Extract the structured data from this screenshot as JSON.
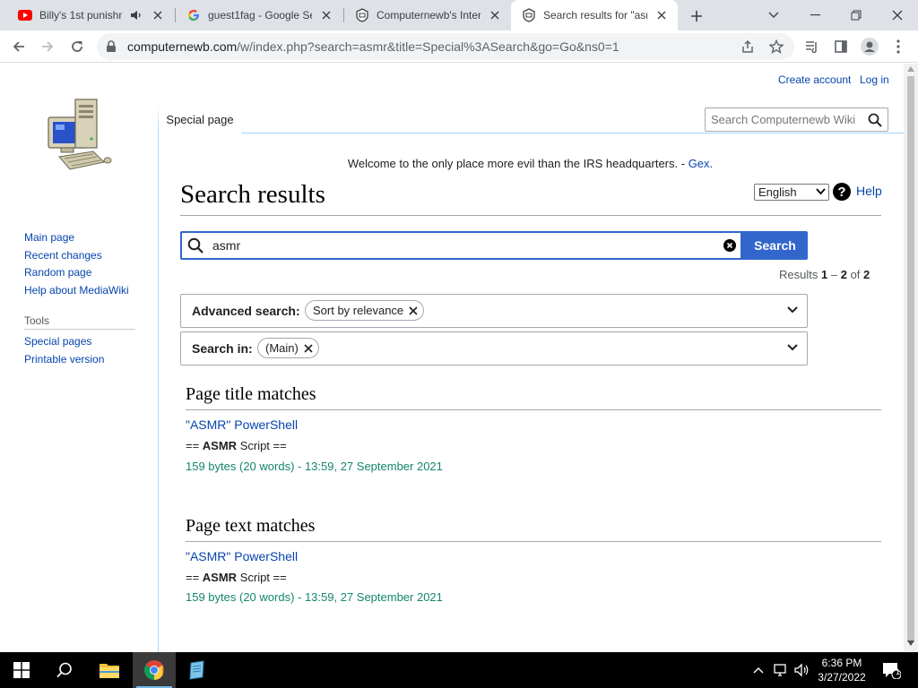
{
  "browser": {
    "tabs": [
      {
        "title": "Billy's 1st punishme",
        "icon": "youtube-icon",
        "audio": true
      },
      {
        "title": "guest1fag - Google Se",
        "icon": "google-icon"
      },
      {
        "title": "Computernewb's Intern",
        "icon": "computernewb-icon"
      },
      {
        "title": "Search results for \"asm",
        "icon": "computernewb-icon",
        "active": true
      }
    ],
    "url_host": "computernewb.com",
    "url_path": "/w/index.php?search=asmr&title=Special%3ASearch&go=Go&ns0=1"
  },
  "wiki": {
    "personal": {
      "create_account": "Create account",
      "login": "Log in"
    },
    "namespace_tab": "Special page",
    "search_placeholder": "Search Computernewb Wiki",
    "sitenotice_text": "Welcome to the only place more evil than the IRS headquarters. -",
    "sitenotice_link": "Gex.",
    "sidebar": {
      "nav": [
        "Main page",
        "Recent changes",
        "Random page",
        "Help about MediaWiki"
      ],
      "tools_heading": "Tools",
      "tools": [
        "Special pages",
        "Printable version"
      ]
    },
    "heading": "Search results",
    "language": "English",
    "help": "Help",
    "search": {
      "query": "asmr",
      "button": "Search"
    },
    "results_info": {
      "prefix": "Results",
      "from": "1",
      "dash": "–",
      "to": "2",
      "of": "of",
      "total": "2"
    },
    "advanced": {
      "label": "Advanced search:",
      "chip": "Sort by relevance"
    },
    "search_in": {
      "label": "Search in:",
      "chip": "(Main)"
    },
    "title_matches": {
      "heading": "Page title matches",
      "result": {
        "title": "\"ASMR\" PowerShell",
        "snippet_pre": "== ",
        "snippet_match": "ASMR",
        "snippet_post": " Script ==",
        "meta": "159 bytes (20 words) - 13:59, 27 September 2021"
      }
    },
    "text_matches": {
      "heading": "Page text matches",
      "result": {
        "title": "\"ASMR\" PowerShell",
        "snippet_pre": "== ",
        "snippet_match": "ASMR",
        "snippet_post": " Script ==",
        "meta": "159 bytes (20 words) - 13:59, 27 September 2021"
      }
    }
  },
  "taskbar": {
    "time": "6:36 PM",
    "date": "3/27/2022",
    "notifications": "1"
  },
  "colors": {
    "link": "#0645ad",
    "accent": "#3366cc",
    "meta_green": "#14866d"
  }
}
